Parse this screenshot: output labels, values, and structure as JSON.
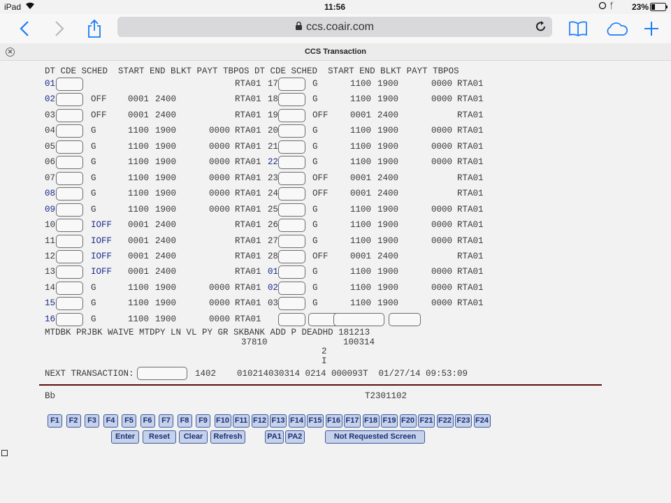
{
  "status_bar": {
    "device": "iPad",
    "time": "11:56",
    "battery": "23%"
  },
  "browser": {
    "url": "ccs.coair.com",
    "page_title": "CCS Transaction"
  },
  "grid": {
    "header": "DT CDE SCHED  START END BLKT PAYT TBPOS DT CDE SCHED  START END BLKT PAYT TBPOS",
    "rows": [
      {
        "dt1": "01",
        "s1": "",
        "st1": "",
        "en1": "",
        "py1": "",
        "tb1": "RTA01",
        "dt2": "17",
        "s2": "G",
        "st2": "1100",
        "en2": "1900",
        "py2": "0000",
        "tb2": "RTA01"
      },
      {
        "dt1": "02",
        "s1": "OFF",
        "st1": "0001",
        "en1": "2400",
        "py1": "",
        "tb1": "RTA01",
        "dt2": "18",
        "s2": "G",
        "st2": "1100",
        "en2": "1900",
        "py2": "0000",
        "tb2": "RTA01"
      },
      {
        "dt1": "03",
        "s1": "OFF",
        "st1": "0001",
        "en1": "2400",
        "py1": "",
        "tb1": "RTA01",
        "dt2": "19",
        "s2": "OFF",
        "st2": "0001",
        "en2": "2400",
        "py2": "",
        "tb2": "RTA01"
      },
      {
        "dt1": "04",
        "s1": "G",
        "st1": "1100",
        "en1": "1900",
        "py1": "0000",
        "tb1": "RTA01",
        "dt2": "20",
        "s2": "G",
        "st2": "1100",
        "en2": "1900",
        "py2": "0000",
        "tb2": "RTA01"
      },
      {
        "dt1": "05",
        "s1": "G",
        "st1": "1100",
        "en1": "1900",
        "py1": "0000",
        "tb1": "RTA01",
        "dt2": "21",
        "s2": "G",
        "st2": "1100",
        "en2": "1900",
        "py2": "0000",
        "tb2": "RTA01"
      },
      {
        "dt1": "06",
        "s1": "G",
        "st1": "1100",
        "en1": "1900",
        "py1": "0000",
        "tb1": "RTA01",
        "dt2": "22",
        "s2": "G",
        "st2": "1100",
        "en2": "1900",
        "py2": "0000",
        "tb2": "RTA01"
      },
      {
        "dt1": "07",
        "s1": "G",
        "st1": "1100",
        "en1": "1900",
        "py1": "0000",
        "tb1": "RTA01",
        "dt2": "23",
        "s2": "OFF",
        "st2": "0001",
        "en2": "2400",
        "py2": "",
        "tb2": "RTA01"
      },
      {
        "dt1": "08",
        "s1": "G",
        "st1": "1100",
        "en1": "1900",
        "py1": "0000",
        "tb1": "RTA01",
        "dt2": "24",
        "s2": "OFF",
        "st2": "0001",
        "en2": "2400",
        "py2": "",
        "tb2": "RTA01"
      },
      {
        "dt1": "09",
        "s1": "G",
        "st1": "1100",
        "en1": "1900",
        "py1": "0000",
        "tb1": "RTA01",
        "dt2": "25",
        "s2": "G",
        "st2": "1100",
        "en2": "1900",
        "py2": "0000",
        "tb2": "RTA01"
      },
      {
        "dt1": "10",
        "s1": "IOFF",
        "st1": "0001",
        "en1": "2400",
        "py1": "",
        "tb1": "RTA01",
        "dt2": "26",
        "s2": "G",
        "st2": "1100",
        "en2": "1900",
        "py2": "0000",
        "tb2": "RTA01"
      },
      {
        "dt1": "11",
        "s1": "IOFF",
        "st1": "0001",
        "en1": "2400",
        "py1": "",
        "tb1": "RTA01",
        "dt2": "27",
        "s2": "G",
        "st2": "1100",
        "en2": "1900",
        "py2": "0000",
        "tb2": "RTA01"
      },
      {
        "dt1": "12",
        "s1": "IOFF",
        "st1": "0001",
        "en1": "2400",
        "py1": "",
        "tb1": "RTA01",
        "dt2": "28",
        "s2": "OFF",
        "st2": "0001",
        "en2": "2400",
        "py2": "",
        "tb2": "RTA01"
      },
      {
        "dt1": "13",
        "s1": "IOFF",
        "st1": "0001",
        "en1": "2400",
        "py1": "",
        "tb1": "RTA01",
        "dt2": "01",
        "s2": "G",
        "st2": "1100",
        "en2": "1900",
        "py2": "0000",
        "tb2": "RTA01"
      },
      {
        "dt1": "14",
        "s1": "G",
        "st1": "1100",
        "en1": "1900",
        "py1": "0000",
        "tb1": "RTA01",
        "dt2": "02",
        "s2": "G",
        "st2": "1100",
        "en2": "1900",
        "py2": "0000",
        "tb2": "RTA01"
      },
      {
        "dt1": "15",
        "s1": "G",
        "st1": "1100",
        "en1": "1900",
        "py1": "0000",
        "tb1": "RTA01",
        "dt2": "03",
        "s2": "G",
        "st2": "1100",
        "en2": "1900",
        "py2": "0000",
        "tb2": "RTA01"
      },
      {
        "dt1": "16",
        "s1": "G",
        "st1": "1100",
        "en1": "1900",
        "py1": "0000",
        "tb1": "RTA01",
        "dt2": "",
        "s2": "",
        "st2": "",
        "en2": "",
        "py2": "",
        "tb2": ""
      }
    ]
  },
  "summary": {
    "header": "MTDBK PRJBK WAIVE MTDPY LN VL PY GR SKBANK ADD P DEADHD 181213",
    "sk_bank": "37810",
    "dead_hd": "100314",
    "mark_1": "2",
    "mark_2": "I"
  },
  "next_transaction": {
    "label": "NEXT TRANSACTION:",
    "input_value": "",
    "info": "1402    010214030314 0214 000093T  01/27/14 09:53:09"
  },
  "footer": {
    "left": "Bb",
    "right": "T2301102"
  },
  "function_keys": [
    "F1",
    "F2",
    "F3",
    "F4",
    "F5",
    "F6",
    "F7",
    "F8",
    "F9",
    "F10",
    "F11",
    "F12",
    "F13",
    "F14",
    "F15",
    "F16",
    "F17",
    "F18",
    "F19",
    "F20",
    "F21",
    "F22",
    "F23",
    "F24"
  ],
  "action_buttons": [
    "Enter",
    "Reset",
    "Clear",
    "Refresh",
    "PA1",
    "PA2",
    "Not Requested Screen"
  ],
  "colors": {
    "terminal_text": "#3a3a3a",
    "date_blue": "#1a2a8c",
    "key_fill": "#c6d2ec",
    "key_border": "#3f5a9a",
    "divider": "#5a1010"
  }
}
